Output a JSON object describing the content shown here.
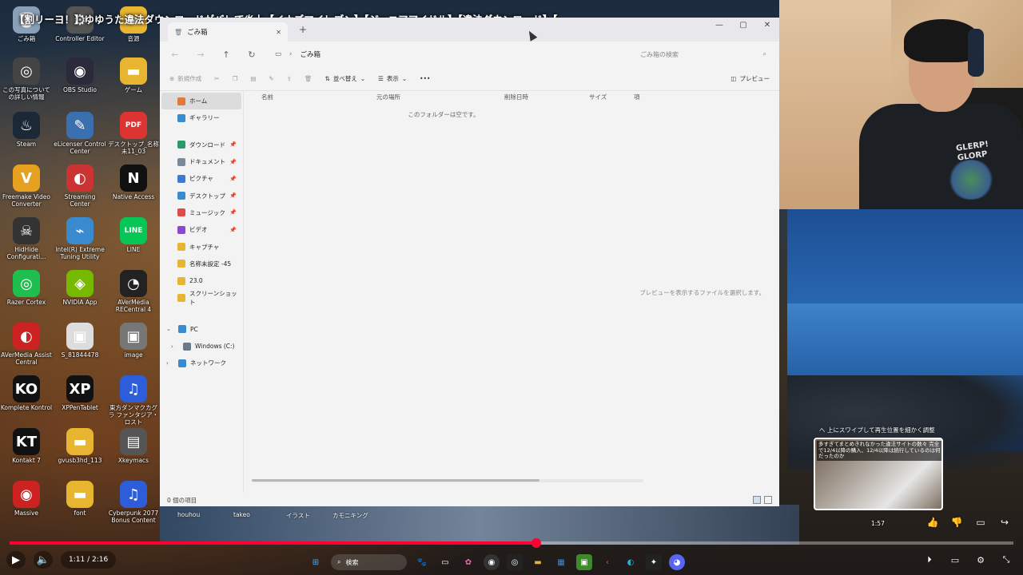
{
  "video_title": "【割リーヨ！】ゆゆうた違法ダウンロードがバレて炎上【イナズマイレブン】【ジュニアアイドル】【違法ダウンロード】【...",
  "desktop_icons": [
    {
      "label": "ごみ箱",
      "icon": "recycle-bin-icon",
      "color": "#8aa0b8",
      "glyph": "🗑"
    },
    {
      "label": "Controller Editor",
      "icon": "controller-icon",
      "color": "#555",
      "glyph": "⚙"
    },
    {
      "label": "音源",
      "icon": "folder-icon",
      "color": "#e8b530",
      "glyph": "▬"
    },
    {
      "label": "この写真についての詳しい情報",
      "icon": "info-icon",
      "color": "#444",
      "glyph": "◎"
    },
    {
      "label": "OBS Studio",
      "icon": "obs-icon",
      "color": "#2a2a3a",
      "glyph": "◉"
    },
    {
      "label": "ゲーム",
      "icon": "folder-icon",
      "color": "#e8b530",
      "glyph": "▬"
    },
    {
      "label": "Steam",
      "icon": "steam-icon",
      "color": "#1b2838",
      "glyph": "♨"
    },
    {
      "label": "eLicenser Control Center",
      "icon": "elicenser-icon",
      "color": "#3a6fb0",
      "glyph": "✎"
    },
    {
      "label": "デスクトップ_名称未11_03",
      "icon": "pdf-icon",
      "color": "#d33",
      "glyph": "PDF"
    },
    {
      "label": "Freemake Video Converter",
      "icon": "freemake-icon",
      "color": "#e8a020",
      "glyph": "V"
    },
    {
      "label": "Streaming Center",
      "icon": "streaming-icon",
      "color": "#c33",
      "glyph": "◐"
    },
    {
      "label": "Native Access",
      "icon": "native-access-icon",
      "color": "#111",
      "glyph": "N"
    },
    {
      "label": "HidHide Configurati...",
      "icon": "hidhide-icon",
      "color": "#333",
      "glyph": "☠"
    },
    {
      "label": "Intel(R) Extreme Tuning Utility",
      "icon": "intel-icon",
      "color": "#3a8ad0",
      "glyph": "⌁"
    },
    {
      "label": "LINE",
      "icon": "line-icon",
      "color": "#06c755",
      "glyph": "LINE"
    },
    {
      "label": "Razer Cortex",
      "icon": "razer-icon",
      "color": "#1fbf4f",
      "glyph": "◎"
    },
    {
      "label": "NVIDIA App",
      "icon": "nvidia-icon",
      "color": "#76b900",
      "glyph": "◈"
    },
    {
      "label": "AVerMedia RECentral 4",
      "icon": "avermedia-icon",
      "color": "#222",
      "glyph": "◔"
    },
    {
      "label": "AVerMedia Assist Central",
      "icon": "avermedia-assist-icon",
      "color": "#c22",
      "glyph": "◐"
    },
    {
      "label": "S_81844478",
      "icon": "image-file-icon",
      "color": "#ddd",
      "glyph": "▣"
    },
    {
      "label": "image",
      "icon": "image-file-icon",
      "color": "#777",
      "glyph": "▣"
    },
    {
      "label": "Komplete Kontrol",
      "icon": "komplete-icon",
      "color": "#111",
      "glyph": "KO"
    },
    {
      "label": "XPPenTablet",
      "icon": "xppen-icon",
      "color": "#111",
      "glyph": "XP"
    },
    {
      "label": "東方ダンマクカグラ ファンタジア・ロスト",
      "icon": "music-icon",
      "color": "#2d5dd8",
      "glyph": "♫"
    },
    {
      "label": "Kontakt 7",
      "icon": "kontakt-icon",
      "color": "#111",
      "glyph": "KT"
    },
    {
      "label": "gvusb3hd_113",
      "icon": "folder-icon",
      "color": "#e8b530",
      "glyph": "▬"
    },
    {
      "label": "Xkeymacs",
      "icon": "xkeymacs-icon",
      "color": "#555",
      "glyph": "▤"
    },
    {
      "label": "Massive",
      "icon": "massive-icon",
      "color": "#c22",
      "glyph": "◉"
    },
    {
      "label": "font",
      "icon": "folder-icon",
      "color": "#e8b530",
      "glyph": "▬"
    },
    {
      "label": "Cyberpunk 2077 Bonus Content",
      "icon": "music-icon",
      "color": "#2d5dd8",
      "glyph": "♫"
    }
  ],
  "bottom_labels": [
    "houhou",
    "takeo",
    "イラスト",
    "カモニキング"
  ],
  "explorer": {
    "tab_title": "ごみ箱",
    "address": "ごみ箱",
    "search_placeholder": "ごみ箱の検索",
    "toolbar": {
      "new": "新規作成",
      "sort": "並べ替え",
      "view": "表示",
      "more": "•••",
      "preview": "プレビュー"
    },
    "nav": [
      {
        "label": "ホーム",
        "icon": "home-icon",
        "color": "#e07a3a",
        "active": true,
        "pinned": false
      },
      {
        "label": "ギャラリー",
        "icon": "gallery-icon",
        "color": "#3a8ad0",
        "active": false,
        "pinned": false
      },
      {
        "label": "ダウンロード",
        "icon": "download-icon",
        "color": "#2a9a6a",
        "active": false,
        "pinned": true
      },
      {
        "label": "ドキュメント",
        "icon": "document-icon",
        "color": "#7a8a9a",
        "active": false,
        "pinned": true
      },
      {
        "label": "ピクチャ",
        "icon": "pictures-icon",
        "color": "#3a7ad0",
        "active": false,
        "pinned": true
      },
      {
        "label": "デスクトップ",
        "icon": "desktop-icon",
        "color": "#3a8ad0",
        "active": false,
        "pinned": true
      },
      {
        "label": "ミュージック",
        "icon": "music-icon",
        "color": "#e04a4a",
        "active": false,
        "pinned": true
      },
      {
        "label": "ビデオ",
        "icon": "video-icon",
        "color": "#8a4ad0",
        "active": false,
        "pinned": true
      },
      {
        "label": "キャプチャ",
        "icon": "folder-icon",
        "color": "#e8b530",
        "active": false,
        "pinned": false
      },
      {
        "label": "名称未設定 -45",
        "icon": "folder-icon",
        "color": "#e8b530",
        "active": false,
        "pinned": false
      },
      {
        "label": "23.0",
        "icon": "folder-icon",
        "color": "#e8b530",
        "active": false,
        "pinned": false
      },
      {
        "label": "スクリーンショット",
        "icon": "folder-icon",
        "color": "#e8b530",
        "active": false,
        "pinned": false
      }
    ],
    "tree": [
      {
        "label": "PC",
        "icon": "pc-icon",
        "color": "#3a8ad0",
        "chev": "⌄"
      },
      {
        "label": "Windows (C:)",
        "icon": "drive-icon",
        "color": "#6a7a8a",
        "chev": "›"
      },
      {
        "label": "ネットワーク",
        "icon": "network-icon",
        "color": "#3a8ad0",
        "chev": "›"
      }
    ],
    "columns": [
      "名前",
      "元の場所",
      "削除日時",
      "サイズ",
      "項"
    ],
    "empty_message": "このフォルダーは空です。",
    "preview_message": "プレビューを表示するファイルを選択します。",
    "status": "0 個の項目"
  },
  "webcam": {
    "shirt_text": "GLERP!\nGLORP"
  },
  "player": {
    "seek_hint": "へ 上にスワイプして再生位置を細かく調整",
    "seek_preview_caption": "多すぎてまとめきれなかった違法サイトの数々 完全で12/4以降の購入、12/4以降は続行しているのは何だったのか",
    "seek_time": "1:57",
    "time_display": "1:11 / 2:16",
    "progress_fraction": 0.525,
    "taskbar_search": "検索"
  }
}
